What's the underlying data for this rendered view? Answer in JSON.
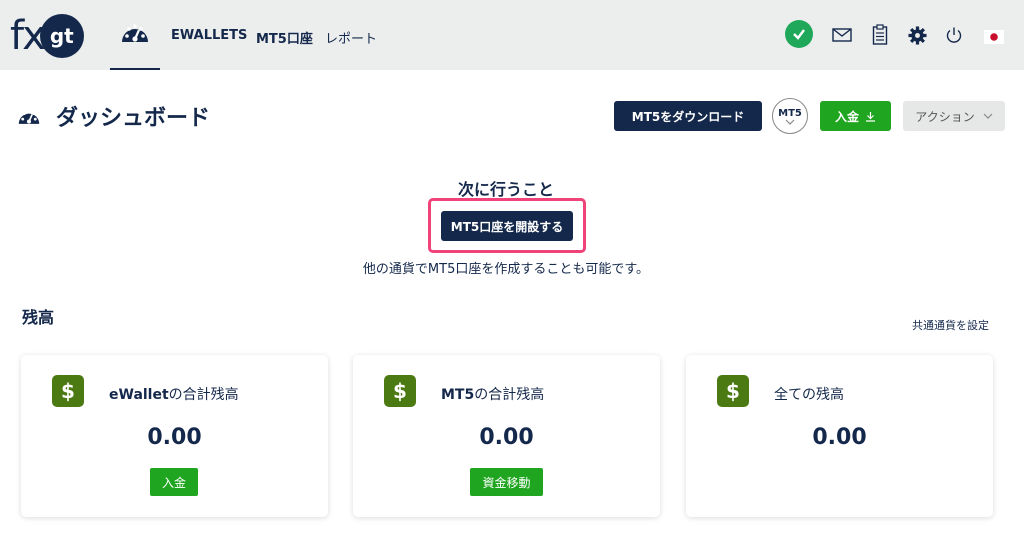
{
  "brand": {
    "logo_main": "fx",
    "logo_circle": "gt"
  },
  "nav": {
    "items": [
      {
        "label": "EWALLETS"
      },
      {
        "label": "MT5口座"
      },
      {
        "label": "レポート"
      }
    ],
    "icons": [
      "dashboard-icon",
      "check-icon",
      "mail-icon",
      "clipboard-icon",
      "gear-icon",
      "power-icon",
      "japan-flag-icon"
    ]
  },
  "header": {
    "title": "ダッシュボード",
    "download_label": "MT5をダウンロード",
    "mt5_badge": "MT5",
    "deposit_label": "入金",
    "action_label": "アクション"
  },
  "next_steps": {
    "title": "次に行うこと",
    "open_account_label": "MT5口座を開設する",
    "subtitle": "他の通貨でMT5口座を作成することも可能です。"
  },
  "balance": {
    "title": "残高",
    "common_currency_link": "共通通貨を設定",
    "cards": [
      {
        "label_bold": "eWallet",
        "label_rest": "の合計残高",
        "amount": "0.00",
        "button": "入金"
      },
      {
        "label_bold": "MT5",
        "label_rest": "の合計残高",
        "amount": "0.00",
        "button": "資金移動"
      },
      {
        "label_bold": "",
        "label_rest": "全ての残高",
        "amount": "0.00",
        "button": ""
      }
    ]
  },
  "colors": {
    "navy": "#14284b",
    "green": "#1fa51f",
    "badge_green": "#4c7a12",
    "highlight": "#f0437a",
    "status_green": "#1fa85a"
  }
}
